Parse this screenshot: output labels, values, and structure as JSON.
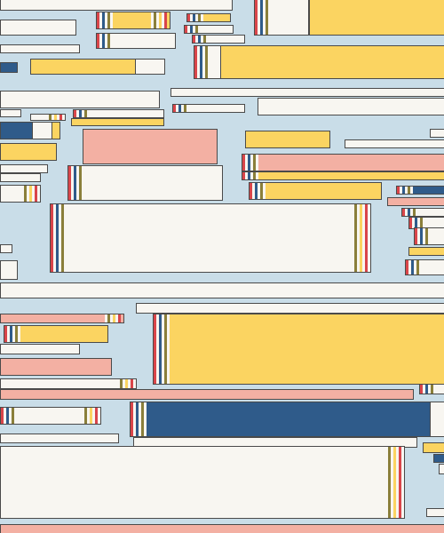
{
  "palette": {
    "background": "#c9dde8",
    "cream": "#f8f6f1",
    "yellow": "#fbd461",
    "pink": "#f3b0a3",
    "navy": "#2f5b8a",
    "outline": "#4a4a4a",
    "olive": "#8a7f3a",
    "red": "#d9454a"
  }
}
